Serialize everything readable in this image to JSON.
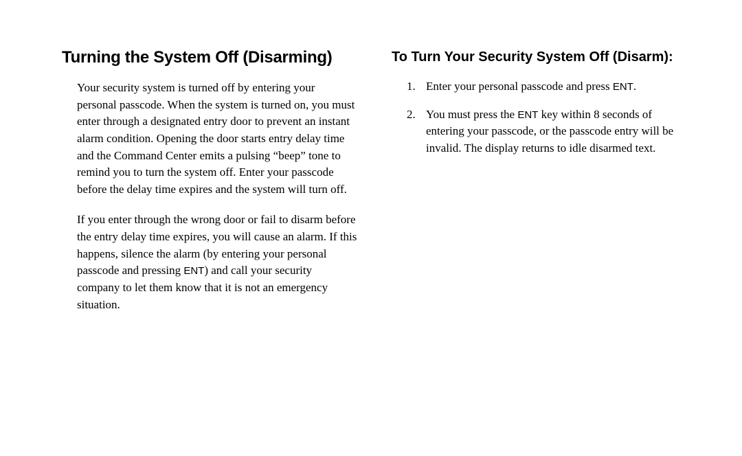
{
  "left": {
    "heading": "Turning the System Off (Disarming)",
    "para1_a": "Your security system is turned off by entering your personal passcode. When the system is turned on, you must enter through a designated entry door to prevent an instant alarm condition. Opening the door starts entry delay time and the Command Center emits a pulsing “beep” tone to remind you to turn the system off. Enter your passcode before the delay time expires and the system will turn off.",
    "para2_a": "If you enter through the wrong door or fail to disarm before the entry delay time expires, you will cause an alarm. If this happens, silence the alarm (by entering your personal passcode and pressing ",
    "para2_ent": "ENT",
    "para2_b": ") and call your security company to let them know that it is not an emergency situation."
  },
  "right": {
    "heading": "To Turn Your Security System Off (Disarm):",
    "item1_num": "1.",
    "item1_a": "Enter your personal passcode and press ",
    "item1_ent": "ENT",
    "item1_b": ".",
    "item2_num": "2.",
    "item2_a": " You must press the ",
    "item2_ent": "ENT",
    "item2_b": " key within 8 seconds of entering your passcode, or the passcode entry will be invalid. The display returns to idle disarmed text."
  }
}
